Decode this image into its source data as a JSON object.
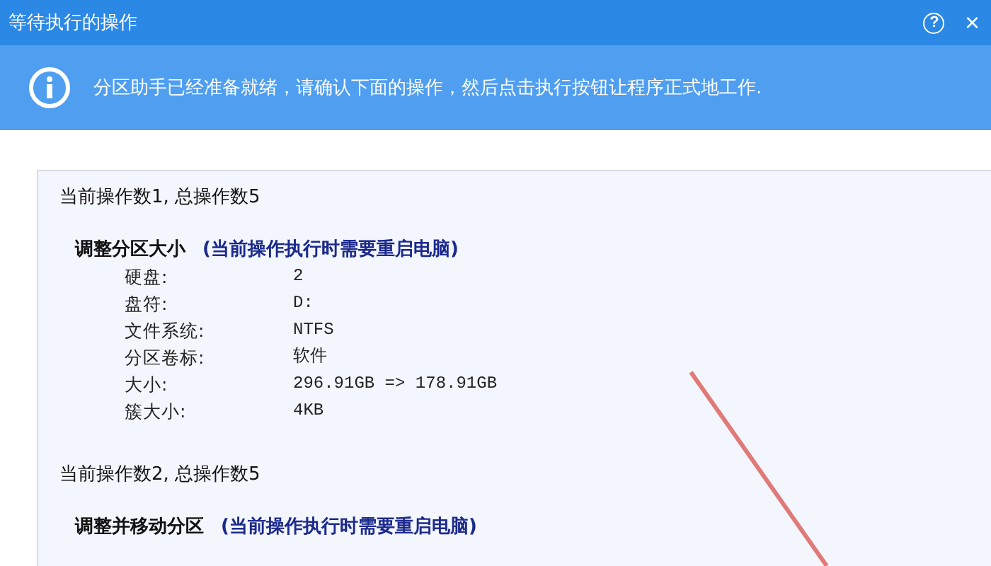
{
  "window": {
    "title": "等待执行的操作",
    "help_button": "?",
    "close_button": "×"
  },
  "info_banner": {
    "text": "分区助手已经准备就绪，请确认下面的操作，然后点击执行按钮让程序正式地工作."
  },
  "operations": [
    {
      "counter": "当前操作数1, 总操作数5",
      "title": "调整分区大小",
      "note": "(当前操作执行时需要重启电脑)",
      "fields": [
        {
          "label": "硬盘:",
          "value": "2"
        },
        {
          "label": "盘符:",
          "value": "D:"
        },
        {
          "label": "文件系统:",
          "value": "NTFS"
        },
        {
          "label": "分区卷标:",
          "value": "软件"
        },
        {
          "label": "大小:",
          "value": "296.91GB => 178.91GB"
        },
        {
          "label": "簇大小:",
          "value": "4KB"
        }
      ]
    },
    {
      "counter": "当前操作数2, 总操作数5",
      "title": "调整并移动分区",
      "note": "(当前操作执行时需要重启电脑)"
    }
  ]
}
